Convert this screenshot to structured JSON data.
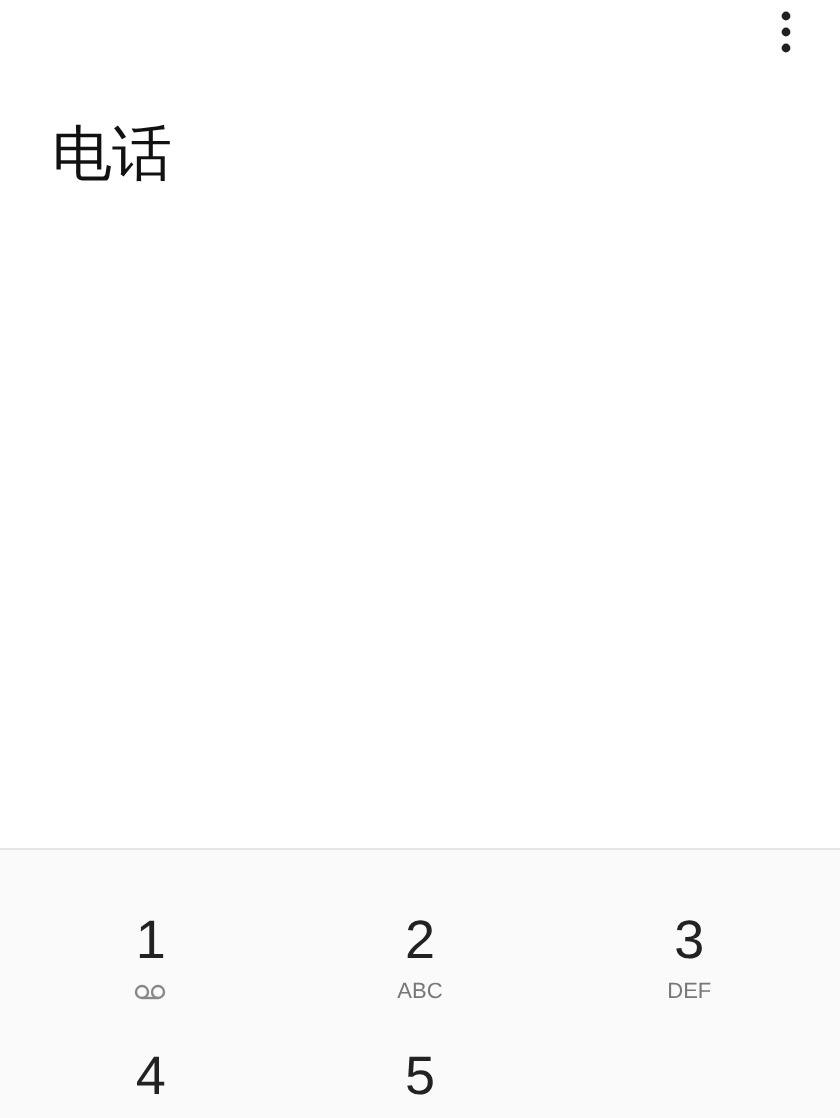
{
  "header": {
    "title": "电话"
  },
  "keypad": [
    {
      "digit": "1",
      "kind": "voicemail"
    },
    {
      "digit": "2",
      "kind": "letters",
      "letters": "ABC"
    },
    {
      "digit": "3",
      "kind": "letters",
      "letters": "DEF"
    },
    {
      "digit": "4",
      "kind": "plain"
    },
    {
      "digit": "5",
      "kind": "plain"
    }
  ]
}
